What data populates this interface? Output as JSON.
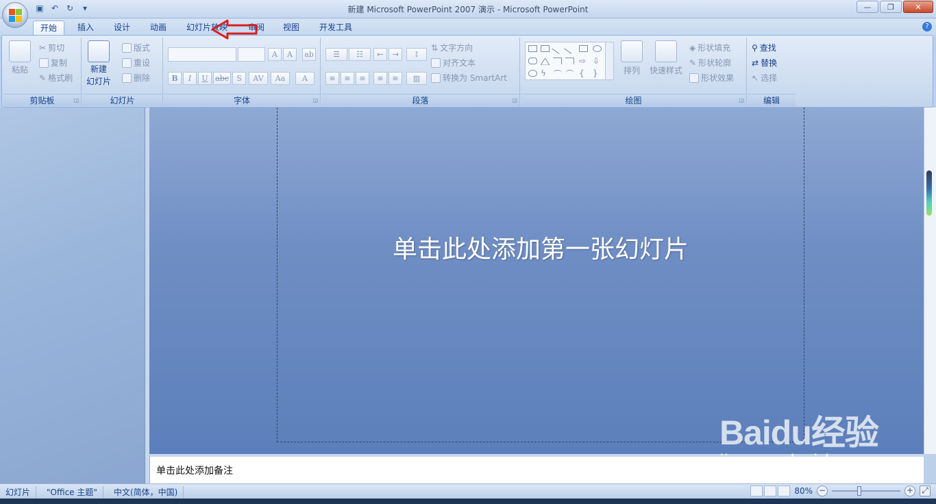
{
  "window": {
    "title": "新建 Microsoft PowerPoint 2007 演示 - Microsoft PowerPoint"
  },
  "tabs": [
    "开始",
    "插入",
    "设计",
    "动画",
    "幻灯片放映",
    "审阅",
    "视图",
    "开发工具"
  ],
  "active_tab": "开始",
  "ribbon": {
    "clipboard": {
      "paste": "粘贴",
      "cut": "剪切",
      "copy": "复制",
      "format_painter": "格式刷",
      "label": "剪贴板"
    },
    "slides": {
      "new_slide_line1": "新建",
      "new_slide_line2": "幻灯片",
      "layout": "版式",
      "reset": "重设",
      "delete": "删除",
      "label": "幻灯片"
    },
    "font": {
      "label": "字体",
      "grow": "A",
      "shrink": "A",
      "bold": "B",
      "italic": "I",
      "underline": "U",
      "strike": "abc",
      "shadow": "S",
      "spacing": "AV",
      "case": "Aa",
      "color": "A"
    },
    "paragraph": {
      "text_direction": "文字方向",
      "align_text": "对齐文本",
      "smartart": "转换为 SmartArt",
      "label": "段落"
    },
    "drawing": {
      "arrange": "排列",
      "quick_styles": "快速样式",
      "shape_fill": "形状填充",
      "shape_outline": "形状轮廓",
      "shape_effects": "形状效果",
      "label": "绘图"
    },
    "editing": {
      "find": "查找",
      "replace": "替换",
      "select": "选择",
      "label": "编辑"
    }
  },
  "slide": {
    "prompt": "单击此处添加第一张幻灯片"
  },
  "notes": {
    "placeholder": "单击此处添加备注"
  },
  "status": {
    "slides": "幻灯片",
    "theme": "\"Office 主题\"",
    "language": "中文(简体，中国)",
    "zoom": "80%",
    "zoom_level": 0.8
  },
  "watermark": {
    "logo": "Baidu经验",
    "url": "jingyan.baidu.com"
  },
  "colors": {
    "accent_red": "#d6201f",
    "slide_blue": "#6f8ec4",
    "ribbon_text": "#15428b"
  }
}
